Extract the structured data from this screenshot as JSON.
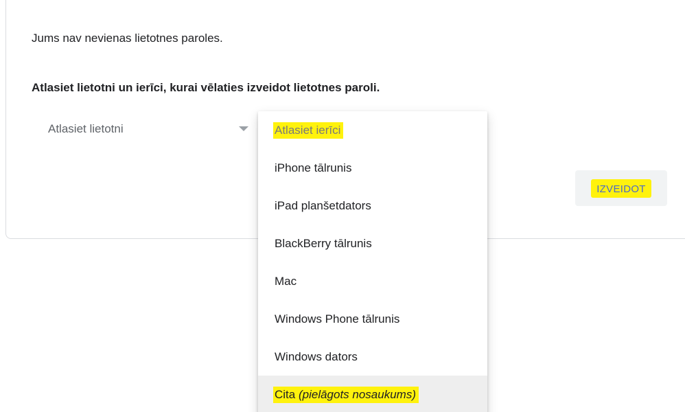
{
  "message": {
    "no_passwords": "Jums nav nevienas lietotnes paroles.",
    "instruction": "Atlasiet lietotni un ierīci, kurai vēlaties izveidot lietotnes paroli."
  },
  "app_select": {
    "value": "Atlasiet lietotni",
    "icon": "dropdown-arrow-icon"
  },
  "device_dropdown": {
    "placeholder": "Atlasiet ierīci",
    "options": [
      "iPhone tālrunis",
      "iPad planšetdators",
      "BlackBerry tālrunis",
      "Mac",
      "Windows Phone tālrunis",
      "Windows dators"
    ],
    "custom_option": {
      "label": "Cita",
      "hint": "(pielāgots nosaukums)"
    }
  },
  "create_button": {
    "label": "IZVEIDOT"
  },
  "colors": {
    "highlight": "#fff100",
    "button_text": "#4d6bc6",
    "active_option_bg": "#eeeeee"
  }
}
